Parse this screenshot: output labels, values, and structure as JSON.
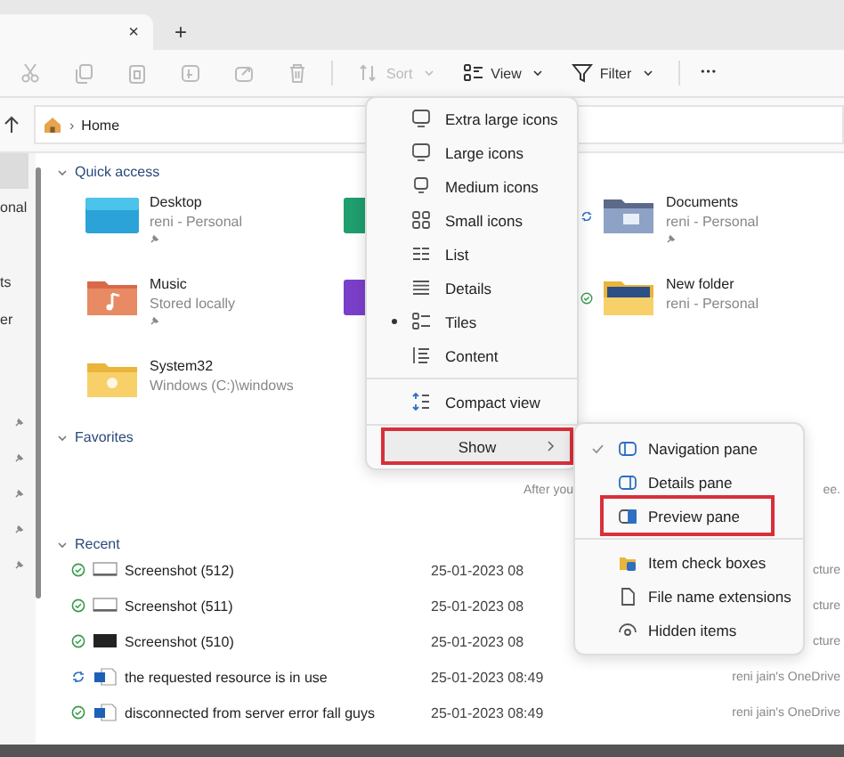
{
  "tabs": {
    "close": "×",
    "new": "+"
  },
  "toolbar": {
    "actions": [
      {
        "kind": "cut",
        "disabled": true
      },
      {
        "kind": "copy",
        "disabled": true
      },
      {
        "kind": "paste",
        "disabled": true
      },
      {
        "kind": "rename",
        "disabled": true
      },
      {
        "kind": "share",
        "disabled": true
      },
      {
        "kind": "delete",
        "disabled": true
      }
    ],
    "menus": [
      {
        "kind": "sort",
        "label": "Sort",
        "disabled": true
      },
      {
        "kind": "view",
        "label": "View",
        "disabled": false
      },
      {
        "kind": "filter",
        "label": "Filter",
        "disabled": false
      }
    ],
    "more": "•••"
  },
  "address": {
    "separator": "›",
    "path": "Home"
  },
  "sidebar": {
    "items": [
      {
        "label": "onal"
      },
      {
        "label": "ts"
      },
      {
        "label": "er"
      },
      {
        "pinned": true
      },
      {
        "pinned": true
      },
      {
        "pinned": true
      },
      {
        "pinned": true
      },
      {
        "pinned": true
      }
    ]
  },
  "quick_access": {
    "title": "Quick access",
    "items": [
      {
        "kind": "desktop",
        "name": "Desktop",
        "detail": "reni - Personal",
        "pinned": true
      },
      {
        "kind": "green"
      },
      {
        "kind": "docs",
        "name": "Documents",
        "detail": "reni - Personal",
        "pinned": true,
        "syncing": true
      },
      {
        "kind": "music",
        "name": "Music",
        "detail": "Stored locally",
        "pinned": true
      },
      {
        "kind": "purple"
      },
      {
        "kind": "pictures",
        "name": "New folder",
        "detail": "reni - Personal",
        "syncing": false
      },
      {
        "kind": "folder",
        "name": "System32",
        "detail": "Windows (C:)\\windows"
      }
    ]
  },
  "favorites": {
    "title": "Favorites",
    "hint_start": "After you",
    "hint_end": "ee."
  },
  "recent": {
    "title": "Recent",
    "rows": [
      {
        "syncing": false,
        "kind": "light",
        "name": "Screenshot (512)",
        "date": "25-01-2023 08",
        "location": "cture"
      },
      {
        "syncing": false,
        "kind": "light",
        "name": "Screenshot (511)",
        "date": "25-01-2023 08",
        "location": "cture"
      },
      {
        "syncing": false,
        "kind": "dark",
        "name": "Screenshot (510)",
        "date": "25-01-2023 08",
        "location": "cture"
      },
      {
        "syncing": true,
        "kind": "word",
        "name": "the requested resource is in use",
        "date": "25-01-2023 08:49",
        "location": "reni jain's OneDrive"
      },
      {
        "syncing": false,
        "kind": "word",
        "name": "disconnected from server error fall guys",
        "date": "25-01-2023 08:49",
        "location": "reni jain's OneDrive"
      }
    ]
  },
  "view_menu": {
    "items": [
      {
        "kind": "monitor",
        "label": "Extra large icons",
        "selected": false,
        "highlighted": false
      },
      {
        "kind": "monitor",
        "label": "Large icons",
        "selected": false,
        "highlighted": false
      },
      {
        "kind": "medium",
        "label": "Medium icons",
        "selected": false,
        "highlighted": false
      },
      {
        "kind": "grid",
        "label": "Small icons",
        "selected": false,
        "highlighted": false
      },
      {
        "kind": "list",
        "label": "List",
        "selected": false,
        "highlighted": false
      },
      {
        "kind": "details",
        "label": "Details",
        "selected": false,
        "highlighted": false
      },
      {
        "kind": "tiles",
        "label": "Tiles",
        "selected": true,
        "highlighted": false
      },
      {
        "kind": "content",
        "label": "Content",
        "selected": false,
        "highlighted": false
      },
      {
        "kind": "compact",
        "label": "Compact view",
        "selected": false,
        "highlighted": false
      },
      {
        "kind": "submenu",
        "label": "Show",
        "selected": false,
        "highlighted": true
      }
    ]
  },
  "show_menu": {
    "items": [
      {
        "kind": "nav",
        "label": "Navigation pane",
        "checked": true,
        "highlighted": false
      },
      {
        "kind": "details",
        "label": "Details pane",
        "checked": false,
        "highlighted": false
      },
      {
        "kind": "preview",
        "label": "Preview pane",
        "checked": false,
        "highlighted": true
      },
      {
        "kind": "checkboxes",
        "label": "Item check boxes",
        "checked": false,
        "highlighted": false
      },
      {
        "kind": "file",
        "label": "File name extensions",
        "checked": false,
        "highlighted": false
      },
      {
        "kind": "eye",
        "label": "Hidden items",
        "checked": false,
        "highlighted": false
      }
    ]
  }
}
